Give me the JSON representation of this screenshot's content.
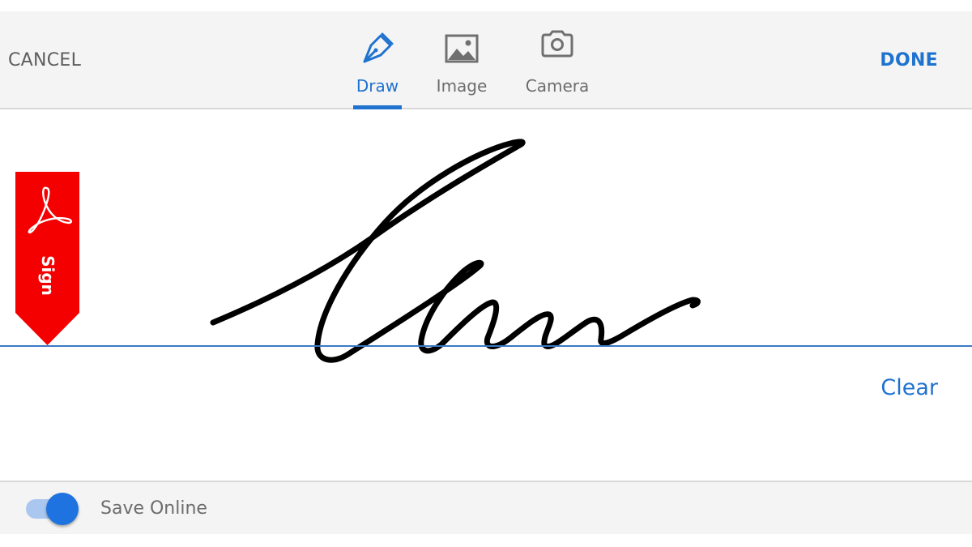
{
  "header": {
    "cancel_label": "CANCEL",
    "done_label": "DONE",
    "tabs": [
      {
        "label": "Draw",
        "icon": "pen-nib-icon",
        "active": true
      },
      {
        "label": "Image",
        "icon": "image-icon",
        "active": false
      },
      {
        "label": "Camera",
        "icon": "camera-icon",
        "active": false
      }
    ]
  },
  "canvas": {
    "badge_text": "Sign",
    "badge_logo": "acrobat-logo-icon",
    "clear_label": "Clear"
  },
  "footer": {
    "toggle_on": true,
    "save_online_label": "Save Online"
  },
  "colors": {
    "accent": "#1f73cf",
    "badge": "#f40000",
    "baseline": "#3a7ac4",
    "header_bg": "#f4f4f4",
    "ink": "#000000"
  }
}
